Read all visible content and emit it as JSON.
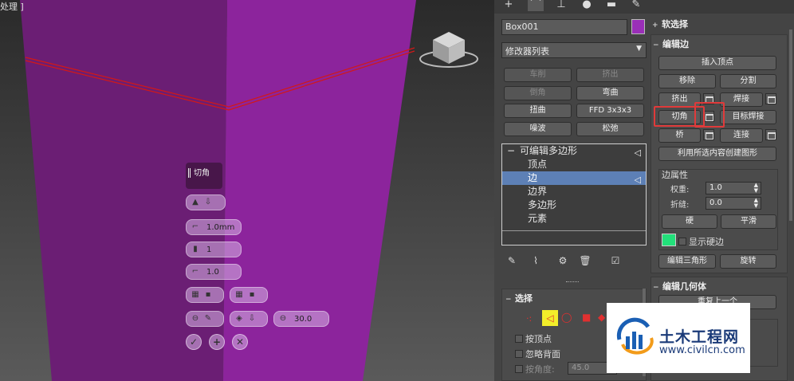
{
  "viewport": {
    "label": "处理 ]",
    "caddy": {
      "title": "切角",
      "amount": "1.0mm",
      "segments": "1",
      "tension": "1.0",
      "angle": "30.0"
    }
  },
  "panel": {
    "object_name": "Box001",
    "object_color": "#9a2fb8",
    "modifier_list": "修改器列表",
    "quick_buttons": [
      "车削",
      "挤出",
      "倒角",
      "弯曲",
      "扭曲",
      "FFD 3x3x3",
      "噪波",
      "松弛"
    ],
    "stack": {
      "root": "可编辑多边形",
      "children": [
        "顶点",
        "边",
        "边界",
        "多边形",
        "元素"
      ],
      "selected": "边"
    },
    "selection": {
      "title": "选择",
      "by_vertex": "按顶点",
      "ignore_backfacing": "忽略背面",
      "by_angle": "按角度:",
      "angle_value": "45.0"
    },
    "soft_selection": {
      "title": "软选择"
    },
    "edit_edges": {
      "title": "编辑边",
      "insert_vertex": "插入顶点",
      "remove": "移除",
      "split": "分割",
      "extrude": "挤出",
      "weld": "焊接",
      "chamfer": "切角",
      "target_weld": "目标焊接",
      "bridge": "桥",
      "connect": "连接",
      "create_shape": "利用所选内容创建图形",
      "edge_properties": "边属性",
      "weight_label": "权重:",
      "weight_value": "1.0",
      "crease_label": "折缝:",
      "crease_value": "0.0",
      "hard": "硬",
      "smooth": "平滑",
      "show_hard_edges": "显示硬边",
      "hard_edge_color": "#22e07a",
      "edit_triangles": "编辑三角形",
      "turn": "旋转"
    },
    "edit_geometry": {
      "title": "编辑几何体",
      "repeat_last": "重复上一个"
    }
  },
  "watermark": {
    "title": "土木工程网",
    "url": "www.civilcn.com"
  }
}
